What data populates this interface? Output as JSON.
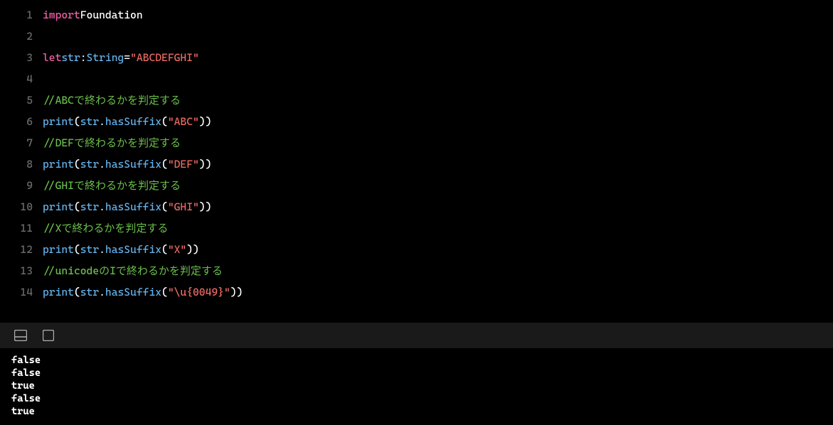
{
  "code_lines": [
    {
      "num": "1",
      "tokens": [
        {
          "cls": "tk-keyword",
          "t": "import"
        },
        {
          "cls": "tk-plain",
          "t": " Foundation"
        }
      ]
    },
    {
      "num": "2",
      "tokens": []
    },
    {
      "num": "3",
      "tokens": [
        {
          "cls": "tk-keyword",
          "t": "let"
        },
        {
          "cls": "tk-plain",
          "t": " "
        },
        {
          "cls": "tk-var",
          "t": "str"
        },
        {
          "cls": "tk-punc",
          "t": ": "
        },
        {
          "cls": "tk-type",
          "t": "String"
        },
        {
          "cls": "tk-punc",
          "t": " = "
        },
        {
          "cls": "tk-string",
          "t": "\"ABCDEFGHI\""
        }
      ]
    },
    {
      "num": "4",
      "tokens": []
    },
    {
      "num": "5",
      "tokens": [
        {
          "cls": "tk-comment",
          "t": "//ABCで終わるかを判定する"
        }
      ]
    },
    {
      "num": "6",
      "tokens": [
        {
          "cls": "tk-func",
          "t": "print"
        },
        {
          "cls": "tk-punc",
          "t": "("
        },
        {
          "cls": "tk-var",
          "t": "str"
        },
        {
          "cls": "tk-punc",
          "t": "."
        },
        {
          "cls": "tk-func",
          "t": "hasSuffix"
        },
        {
          "cls": "tk-punc",
          "t": "("
        },
        {
          "cls": "tk-string",
          "t": "\"ABC\""
        },
        {
          "cls": "tk-punc",
          "t": "))"
        }
      ]
    },
    {
      "num": "7",
      "tokens": [
        {
          "cls": "tk-comment",
          "t": "//DEFで終わるかを判定する"
        }
      ]
    },
    {
      "num": "8",
      "tokens": [
        {
          "cls": "tk-func",
          "t": "print"
        },
        {
          "cls": "tk-punc",
          "t": "("
        },
        {
          "cls": "tk-var",
          "t": "str"
        },
        {
          "cls": "tk-punc",
          "t": "."
        },
        {
          "cls": "tk-func",
          "t": "hasSuffix"
        },
        {
          "cls": "tk-punc",
          "t": "("
        },
        {
          "cls": "tk-string",
          "t": "\"DEF\""
        },
        {
          "cls": "tk-punc",
          "t": "))"
        }
      ]
    },
    {
      "num": "9",
      "tokens": [
        {
          "cls": "tk-comment",
          "t": "//GHIで終わるかを判定する"
        }
      ]
    },
    {
      "num": "10",
      "tokens": [
        {
          "cls": "tk-func",
          "t": "print"
        },
        {
          "cls": "tk-punc",
          "t": "("
        },
        {
          "cls": "tk-var",
          "t": "str"
        },
        {
          "cls": "tk-punc",
          "t": "."
        },
        {
          "cls": "tk-func",
          "t": "hasSuffix"
        },
        {
          "cls": "tk-punc",
          "t": "("
        },
        {
          "cls": "tk-string",
          "t": "\"GHI\""
        },
        {
          "cls": "tk-punc",
          "t": "))"
        }
      ]
    },
    {
      "num": "11",
      "tokens": [
        {
          "cls": "tk-comment",
          "t": "//Xで終わるかを判定する"
        }
      ]
    },
    {
      "num": "12",
      "tokens": [
        {
          "cls": "tk-func",
          "t": "print"
        },
        {
          "cls": "tk-punc",
          "t": "("
        },
        {
          "cls": "tk-var",
          "t": "str"
        },
        {
          "cls": "tk-punc",
          "t": "."
        },
        {
          "cls": "tk-func",
          "t": "hasSuffix"
        },
        {
          "cls": "tk-punc",
          "t": "("
        },
        {
          "cls": "tk-string",
          "t": "\"X\""
        },
        {
          "cls": "tk-punc",
          "t": "))"
        }
      ]
    },
    {
      "num": "13",
      "tokens": [
        {
          "cls": "tk-comment",
          "t": "//unicodeのIで終わるかを判定する"
        }
      ]
    },
    {
      "num": "14",
      "tokens": [
        {
          "cls": "tk-func",
          "t": "print"
        },
        {
          "cls": "tk-punc",
          "t": "("
        },
        {
          "cls": "tk-var",
          "t": "str"
        },
        {
          "cls": "tk-punc",
          "t": "."
        },
        {
          "cls": "tk-func",
          "t": "hasSuffix"
        },
        {
          "cls": "tk-punc",
          "t": "("
        },
        {
          "cls": "tk-string",
          "t": "\"\\u{0049}\""
        },
        {
          "cls": "tk-punc",
          "t": "))"
        }
      ]
    }
  ],
  "console_output": [
    "false",
    "false",
    "true",
    "false",
    "true"
  ]
}
